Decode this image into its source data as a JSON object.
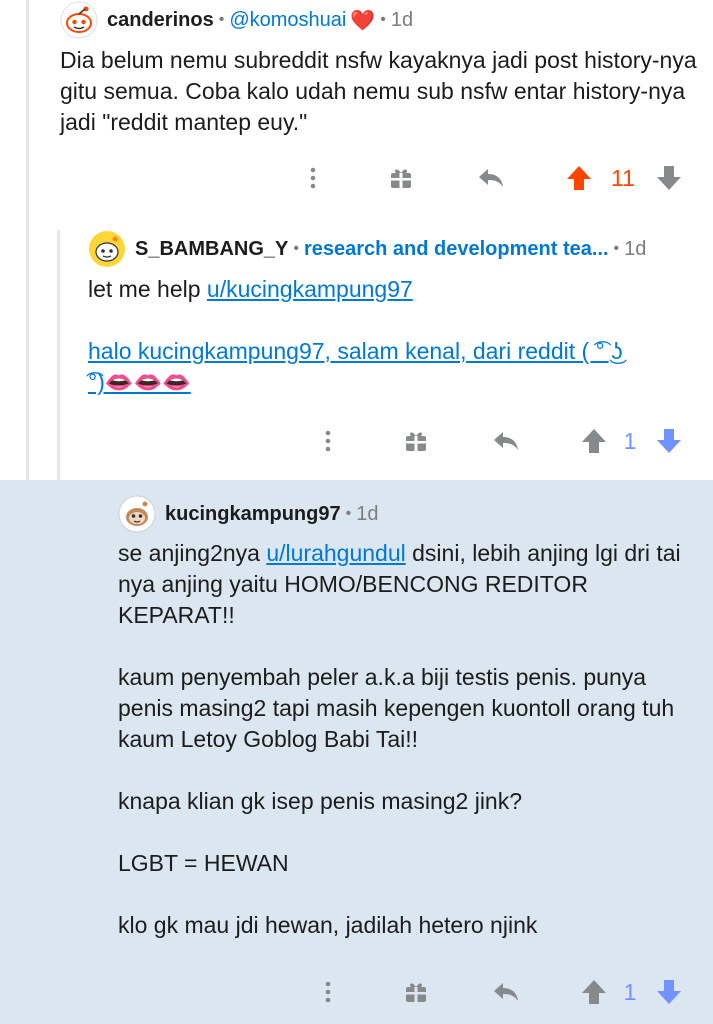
{
  "comments": [
    {
      "username": "canderinos",
      "flair": "@komoshuai",
      "flair_emoji": "❤️",
      "time": "1d",
      "body": "Dia belum nemu subreddit nsfw kayaknya jadi post history-nya gitu semua. Coba kalo udah nemu sub nsfw entar history-nya jadi \"reddit mantep euy.\"",
      "score": "11",
      "vote_state": "upvoted",
      "colors": {
        "score": "#ff4500",
        "avatar_bg": "#ffffff"
      }
    },
    {
      "username": "S_BAMBANG_Y",
      "flair": "research and development tea...",
      "time": "1d",
      "body_intro": "let me help ",
      "body_link": "u/kucingkampung97",
      "body_link_line1": "halo kucingkampung97, salam kenal, dari reddit ( ͡° ͜ʖ",
      "body_link_line2": "͡°)👄👄👄",
      "score": "1",
      "vote_state": "downvoted",
      "colors": {
        "score": "#7193ff"
      }
    },
    {
      "username": "kucingkampung97",
      "time": "1d",
      "body_p1_pre": "se anjing2nya ",
      "body_p1_link": "u/lurahgundul",
      "body_p1_post": " dsini, lebih anjing lgi dri tai nya anjing yaitu HOMO/BENCONG REDITOR KEPARAT!!",
      "body_p2": "kaum penyembah peler a.k.a biji testis penis. punya penis masing2 tapi masih kepengen kuontoll orang tuh kaum Letoy Goblog Babi Tai!!",
      "body_p3": "knapa klian gk isep penis masing2 jink?",
      "body_p4": "LGBT = HEWAN",
      "body_p5": "klo gk mau jdi hewan, jadilah hetero njink",
      "score": "1",
      "vote_state": "downvoted",
      "colors": {
        "score": "#7193ff",
        "background": "#dbe6f0"
      }
    }
  ],
  "icons": {
    "more": "more-vertical-icon",
    "award": "gift-award-icon",
    "reply": "reply-arrow-icon",
    "upvote": "upvote-arrow-icon",
    "downvote": "downvote-arrow-icon"
  },
  "colors": {
    "text": "#1c1c1c",
    "meta": "#7c7c7c",
    "link": "#0079d3",
    "icon": "#878a8c",
    "thread_line": "#e6e6e6"
  }
}
